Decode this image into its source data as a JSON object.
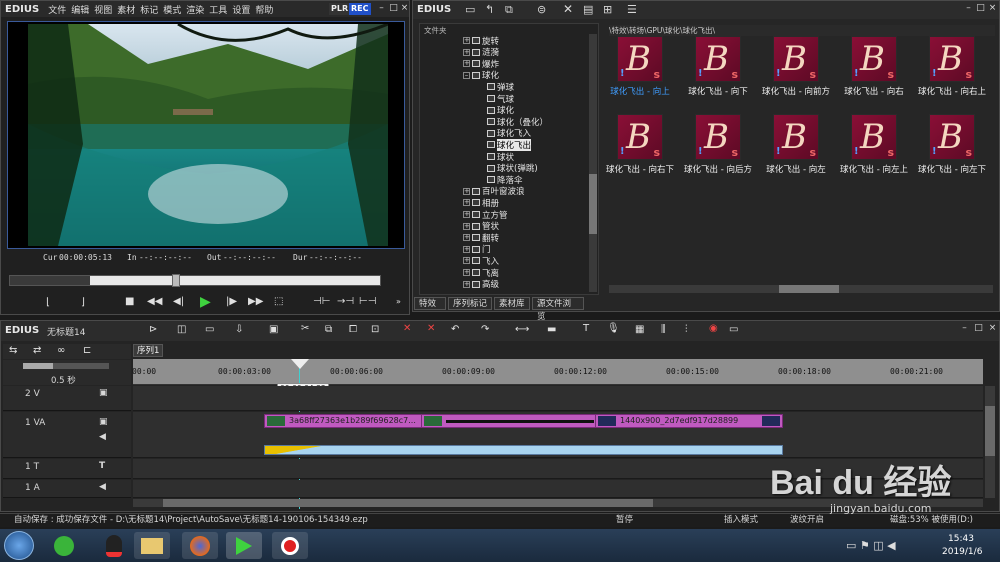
{
  "app": {
    "name": "EDIUS",
    "menu": [
      "文件",
      "编辑",
      "视图",
      "素材",
      "标记",
      "模式",
      "渲染",
      "工具",
      "设置",
      "帮助"
    ],
    "plr": "PLR",
    "rec": "REC"
  },
  "player": {
    "cur_label": "Cur",
    "cur": "00:00:05:13",
    "in_label": "In",
    "in": "--:--:--:--",
    "out_label": "Out",
    "out": "--:--:--:--",
    "dur_label": "Dur",
    "dur": "--:--:--:--"
  },
  "bin": {
    "title": "EDIUS",
    "folder_header": "文件夹",
    "path": "\\特效\\转场\\GPU\\球化\\球化飞出\\",
    "tree": [
      {
        "label": "旋转",
        "indent": 0
      },
      {
        "label": "涟漪",
        "indent": 0
      },
      {
        "label": "爆炸",
        "indent": 0
      },
      {
        "label": "球化",
        "indent": 0
      },
      {
        "label": "弹球",
        "indent": 1
      },
      {
        "label": "气球",
        "indent": 1
      },
      {
        "label": "球化",
        "indent": 1
      },
      {
        "label": "球化（叠化）",
        "indent": 1
      },
      {
        "label": "球化飞入",
        "indent": 1
      },
      {
        "label": "球化飞出",
        "indent": 1
      },
      {
        "label": "球状",
        "indent": 1
      },
      {
        "label": "球状(弹跳)",
        "indent": 1
      },
      {
        "label": "降落伞",
        "indent": 1
      },
      {
        "label": "百叶窗波浪",
        "indent": 0
      },
      {
        "label": "相册",
        "indent": 0
      },
      {
        "label": "立方管",
        "indent": 0
      },
      {
        "label": "管状",
        "indent": 0
      },
      {
        "label": "翻转",
        "indent": 0
      },
      {
        "label": "门",
        "indent": 0
      },
      {
        "label": "飞入",
        "indent": 0
      },
      {
        "label": "飞离",
        "indent": 0
      },
      {
        "label": "高级",
        "indent": 0
      }
    ],
    "effects": [
      "球化飞出 - 向上",
      "球化飞出 - 向下",
      "球化飞出 - 向前方",
      "球化飞出 - 向右",
      "球化飞出 - 向右上",
      "球化飞出 - 向右下",
      "球化飞出 - 向后方",
      "球化飞出 - 向左",
      "球化飞出 - 向左上",
      "球化飞出 - 向左下"
    ],
    "tabs": [
      "特效",
      "序列标记",
      "素材库",
      "源文件浏览"
    ]
  },
  "timeline": {
    "title": "EDIUS",
    "project": "无标题14",
    "sequence": "序列1",
    "zoom": "0.5 秒",
    "cursor_tc": "00:00:04:22",
    "ruler": [
      "00:00",
      "00:00:03:00",
      "00:00:06:00",
      "00:00:09:00",
      "00:00:12:00",
      "00:00:15:00",
      "00:00:18:00",
      "00:00:21:00",
      "00:0"
    ],
    "tracks": [
      {
        "name": "2 V"
      },
      {
        "name": "1 VA"
      },
      {
        "name": "1 T"
      },
      {
        "name": "1 A"
      }
    ],
    "clip1": "3a68ff27363e1b289f69628c7...",
    "clip2": "1440x900_2d7edf917d28899"
  },
  "status": {
    "autosave": "自动保存 : 成功保存文件 - D:\\无标题14\\Project\\AutoSave\\无标题14-190106-154349.ezp",
    "pause": "暂停",
    "insert": "插入模式",
    "ripple": "波纹开启",
    "disk": "磁盘:53% 被使用(D:)"
  },
  "taskbar": {
    "time": "15:43",
    "date": "2019/1/6"
  },
  "watermark": {
    "text": "Bai du 经验",
    "url": "jingyan.baidu.com"
  }
}
